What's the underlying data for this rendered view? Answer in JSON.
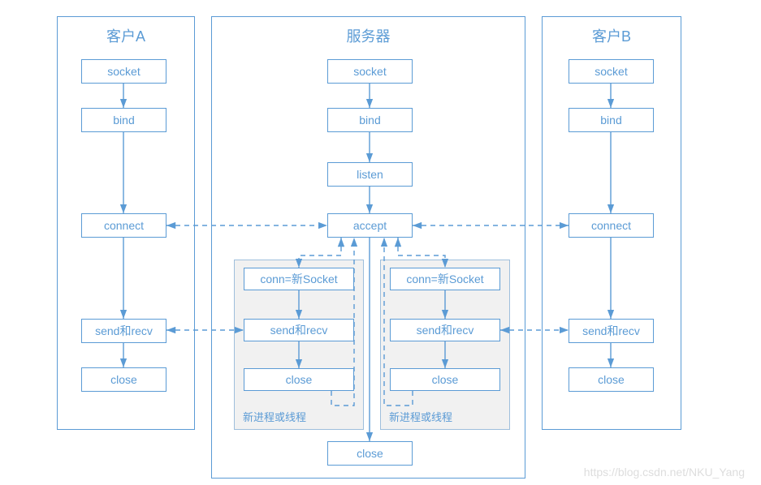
{
  "columns": {
    "clientA": {
      "title": "客户A"
    },
    "server": {
      "title": "服务器"
    },
    "clientB": {
      "title": "客户B"
    }
  },
  "nodes": {
    "clientA": {
      "socket": "socket",
      "bind": "bind",
      "connect": "connect",
      "sendrecv": "send和recv",
      "close": "close"
    },
    "server": {
      "socket": "socket",
      "bind": "bind",
      "listen": "listen",
      "accept": "accept",
      "close": "close"
    },
    "clientB": {
      "socket": "socket",
      "bind": "bind",
      "connect": "connect",
      "sendrecv": "send和recv",
      "close": "close"
    },
    "threadA": {
      "conn": "conn=新Socket",
      "sendrecv": "send和recv",
      "close": "close",
      "label": "新进程或线程"
    },
    "threadB": {
      "conn": "conn=新Socket",
      "sendrecv": "send和recv",
      "close": "close",
      "label": "新进程或线程"
    }
  },
  "watermark": "https://blog.csdn.net/NKU_Yang",
  "chart_data": {
    "type": "flowchart",
    "title": "TCP Socket Client-Server Communication",
    "lanes": [
      {
        "id": "clientA",
        "label": "客户A"
      },
      {
        "id": "server",
        "label": "服务器"
      },
      {
        "id": "clientB",
        "label": "客户B"
      }
    ],
    "subgroups": [
      {
        "id": "threadA",
        "lane": "server",
        "label": "新进程或线程"
      },
      {
        "id": "threadB",
        "lane": "server",
        "label": "新进程或线程"
      }
    ],
    "nodes": [
      {
        "id": "a_socket",
        "lane": "clientA",
        "label": "socket"
      },
      {
        "id": "a_bind",
        "lane": "clientA",
        "label": "bind"
      },
      {
        "id": "a_connect",
        "lane": "clientA",
        "label": "connect"
      },
      {
        "id": "a_sendrecv",
        "lane": "clientA",
        "label": "send和recv"
      },
      {
        "id": "a_close",
        "lane": "clientA",
        "label": "close"
      },
      {
        "id": "s_socket",
        "lane": "server",
        "label": "socket"
      },
      {
        "id": "s_bind",
        "lane": "server",
        "label": "bind"
      },
      {
        "id": "s_listen",
        "lane": "server",
        "label": "listen"
      },
      {
        "id": "s_accept",
        "lane": "server",
        "label": "accept"
      },
      {
        "id": "s_close",
        "lane": "server",
        "label": "close"
      },
      {
        "id": "b_socket",
        "lane": "clientB",
        "label": "socket"
      },
      {
        "id": "b_bind",
        "lane": "clientB",
        "label": "bind"
      },
      {
        "id": "b_connect",
        "lane": "clientB",
        "label": "connect"
      },
      {
        "id": "b_sendrecv",
        "lane": "clientB",
        "label": "send和recv"
      },
      {
        "id": "b_close",
        "lane": "clientB",
        "label": "close"
      },
      {
        "id": "ta_conn",
        "lane": "server",
        "group": "threadA",
        "label": "conn=新Socket"
      },
      {
        "id": "ta_sendrecv",
        "lane": "server",
        "group": "threadA",
        "label": "send和recv"
      },
      {
        "id": "ta_close",
        "lane": "server",
        "group": "threadA",
        "label": "close"
      },
      {
        "id": "tb_conn",
        "lane": "server",
        "group": "threadB",
        "label": "conn=新Socket"
      },
      {
        "id": "tb_sendrecv",
        "lane": "server",
        "group": "threadB",
        "label": "send和recv"
      },
      {
        "id": "tb_close",
        "lane": "server",
        "group": "threadB",
        "label": "close"
      }
    ],
    "edges": [
      {
        "from": "a_socket",
        "to": "a_bind",
        "style": "solid"
      },
      {
        "from": "a_bind",
        "to": "a_connect",
        "style": "solid"
      },
      {
        "from": "a_connect",
        "to": "a_sendrecv",
        "style": "solid"
      },
      {
        "from": "a_sendrecv",
        "to": "a_close",
        "style": "solid"
      },
      {
        "from": "s_socket",
        "to": "s_bind",
        "style": "solid"
      },
      {
        "from": "s_bind",
        "to": "s_listen",
        "style": "solid"
      },
      {
        "from": "s_listen",
        "to": "s_accept",
        "style": "solid"
      },
      {
        "from": "s_accept",
        "to": "s_close",
        "style": "solid"
      },
      {
        "from": "b_socket",
        "to": "b_bind",
        "style": "solid"
      },
      {
        "from": "b_bind",
        "to": "b_connect",
        "style": "solid"
      },
      {
        "from": "b_connect",
        "to": "b_sendrecv",
        "style": "solid"
      },
      {
        "from": "b_sendrecv",
        "to": "b_close",
        "style": "solid"
      },
      {
        "from": "ta_conn",
        "to": "ta_sendrecv",
        "style": "solid"
      },
      {
        "from": "ta_sendrecv",
        "to": "ta_close",
        "style": "solid"
      },
      {
        "from": "tb_conn",
        "to": "tb_sendrecv",
        "style": "solid"
      },
      {
        "from": "tb_sendrecv",
        "to": "tb_close",
        "style": "solid"
      },
      {
        "from": "a_connect",
        "to": "s_accept",
        "style": "dashed",
        "bidir": true
      },
      {
        "from": "b_connect",
        "to": "s_accept",
        "style": "dashed",
        "bidir": true
      },
      {
        "from": "s_accept",
        "to": "ta_conn",
        "style": "dashed",
        "bidir": true
      },
      {
        "from": "s_accept",
        "to": "tb_conn",
        "style": "dashed",
        "bidir": true
      },
      {
        "from": "a_sendrecv",
        "to": "ta_sendrecv",
        "style": "dashed",
        "bidir": true
      },
      {
        "from": "b_sendrecv",
        "to": "tb_sendrecv",
        "style": "dashed",
        "bidir": true
      },
      {
        "from": "ta_close",
        "to": "s_accept",
        "style": "dashed"
      },
      {
        "from": "tb_close",
        "to": "s_accept",
        "style": "dashed"
      }
    ]
  }
}
